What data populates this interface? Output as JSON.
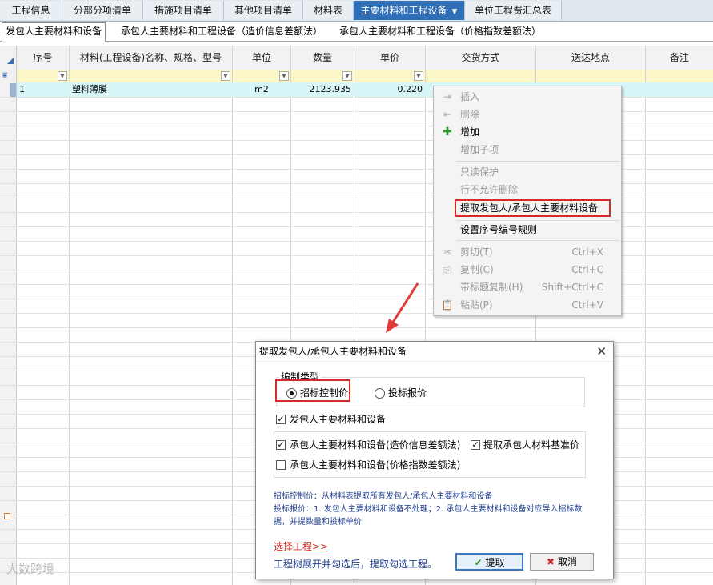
{
  "top_tabs": [
    {
      "label": "工程信息"
    },
    {
      "label": "分部分项清单"
    },
    {
      "label": "措施项目清单"
    },
    {
      "label": "其他项目清单"
    },
    {
      "label": "材料表"
    },
    {
      "label": "主要材料和工程设备",
      "active": true
    },
    {
      "label": "单位工程费汇总表"
    }
  ],
  "sub_tabs": [
    {
      "label": "发包人主要材料和设备",
      "active": true
    },
    {
      "label": "承包人主要材料和工程设备（造价信息差额法）"
    },
    {
      "label": "承包人主要材料和工程设备（价格指数差额法）"
    }
  ],
  "grid": {
    "columns": [
      "序号",
      "材料(工程设备)名称、规格、型号",
      "单位",
      "数量",
      "单价",
      "交货方式",
      "送达地点",
      "备注"
    ],
    "rows": [
      {
        "seq": "1",
        "name": "塑料薄膜",
        "unit": "m2",
        "qty": "2123.935",
        "price": "0.220"
      }
    ]
  },
  "context_menu": {
    "items": [
      {
        "label": "插入",
        "disabled": true,
        "icon": "insert-row-icon"
      },
      {
        "label": "删除",
        "disabled": true,
        "icon": "delete-row-icon"
      },
      {
        "label": "增加",
        "disabled": false,
        "icon": "plus-icon"
      },
      {
        "label": "增加子项",
        "disabled": true
      },
      {
        "label": "只读保护",
        "disabled": true
      },
      {
        "label": "行不允许删除",
        "disabled": true
      },
      {
        "label": "提取发包人/承包人主要材料设备",
        "disabled": false,
        "highlighted": true
      },
      {
        "label": "设置序号编号规则",
        "disabled": false
      },
      {
        "label": "剪切(T)",
        "shortcut": "Ctrl+X",
        "disabled": true,
        "icon": "cut-icon"
      },
      {
        "label": "复制(C)",
        "shortcut": "Ctrl+C",
        "disabled": true,
        "icon": "copy-icon"
      },
      {
        "label": "带标题复制(H)",
        "shortcut": "Shift+Ctrl+C",
        "disabled": true
      },
      {
        "label": "粘贴(P)",
        "shortcut": "Ctrl+V",
        "disabled": true,
        "icon": "paste-icon"
      }
    ]
  },
  "dialog": {
    "title": "提取发包人/承包人主要材料和设备",
    "group_label": "编制类型",
    "radio_bid_control": "招标控制价",
    "radio_bid_quote": "投标报价",
    "selected_radio": "招标控制价",
    "chk_employer": "发包人主要材料和设备",
    "chk_contractor_info": "承包人主要材料和设备(造价信息差额法)",
    "chk_extract_base": "提取承包人材料基准价",
    "chk_contractor_index": "承包人主要材料和设备(价格指数差额法)",
    "checked": {
      "employer": true,
      "contractor_info": true,
      "extract_base": true,
      "contractor_index": false
    },
    "note_line1": "招标控制价：从材料表提取所有发包人/承包人主要材料和设备",
    "note_line2": "投标报价：1. 发包人主要材料和设备不处理；2. 承包人主要材料和设备对应导入招标数",
    "note_line3": "据，并提数量和投标单价",
    "select_link": "选择工程>>",
    "hint": "工程树展开并勾选后，提取勾选工程。",
    "ok_label": "提取",
    "cancel_label": "取消"
  },
  "watermark": "大数跨境",
  "colors": {
    "active_tab": "#2f6fb7",
    "row_highlight": "#d8f6f8",
    "filter_row": "#fbf7c8",
    "red_outline": "#d52a2a"
  }
}
